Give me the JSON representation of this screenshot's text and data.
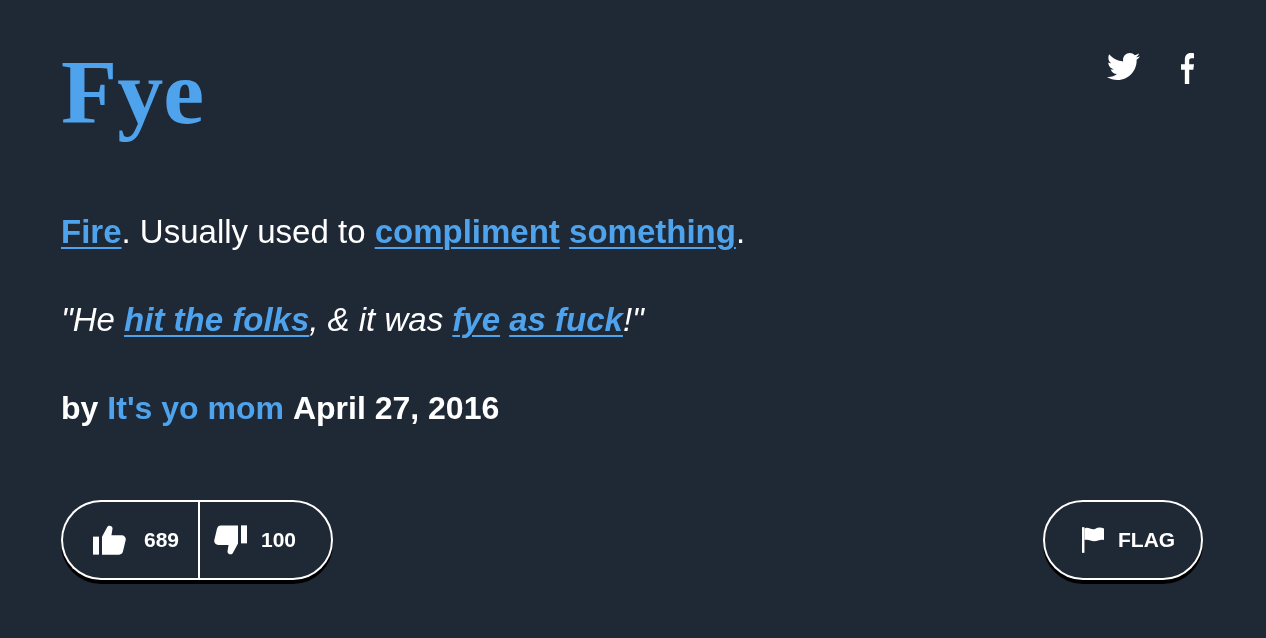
{
  "title": "Fye",
  "meaning": [
    {
      "kind": "link",
      "text": "Fire"
    },
    {
      "kind": "text",
      "text": ". Usually used to "
    },
    {
      "kind": "link",
      "text": "compliment"
    },
    {
      "kind": "link",
      "text": "something"
    },
    {
      "kind": "text",
      "text": "."
    }
  ],
  "example": [
    {
      "kind": "text",
      "text": "\"He "
    },
    {
      "kind": "link",
      "text": "hit the folks"
    },
    {
      "kind": "text",
      "text": ", & it was "
    },
    {
      "kind": "link",
      "text": "fye"
    },
    {
      "kind": "link",
      "text": "as fuck"
    },
    {
      "kind": "text",
      "text": "!\""
    }
  ],
  "contributor": {
    "prefix": "by",
    "author": "It's yo mom",
    "date": "April 27, 2016"
  },
  "votes": {
    "up": "689",
    "down": "100"
  },
  "flag": {
    "label": "FLAG"
  }
}
